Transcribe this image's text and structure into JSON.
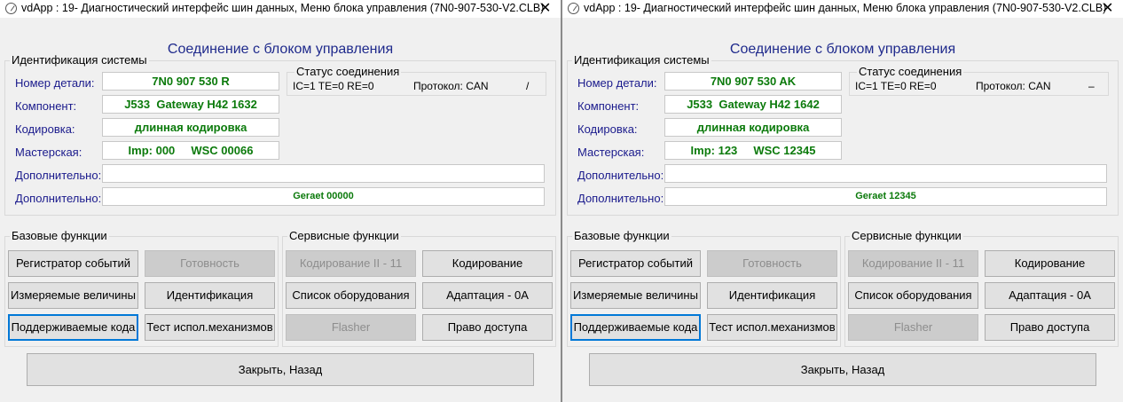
{
  "windows": [
    {
      "title": "vdApp : 19- Диагностический интерфейс шин данных,  Меню блока управления (7N0-907-530-V2.CLB)",
      "heading": "Соединение с блоком управления",
      "ident": {
        "group_label": "Идентификация системы",
        "part_label": "Номер детали:",
        "part_value": "7N0 907 530 R",
        "component_label": "Компонент:",
        "component_value": "J533  Gateway H42 1632",
        "coding_label": "Кодировка:",
        "coding_value": "длинная кодировка",
        "workshop_label": "Мастерская:",
        "workshop_value": "Imp: 000     WSC 00066",
        "extra1_label": "Дополнительно:",
        "extra1_value": "",
        "extra2_label": "Дополнительно:",
        "extra2_value": "Geraet 00000"
      },
      "status": {
        "group_label": "Статус соединения",
        "counters": "IC=1  TE=0   RE=0",
        "protocol": "Протокол: CAN",
        "indicator": "/"
      },
      "basic": {
        "group_label": "Базовые функции",
        "event_log": "Регистратор событий",
        "readiness": "Готовность",
        "measured": "Измеряемые величины",
        "identification": "Идентификация",
        "supported_codes": "Поддерживаемые кода",
        "actuator_test": "Тест испол.механизмов"
      },
      "service": {
        "group_label": "Сервисные функции",
        "coding2": "Кодирование II - 11",
        "coding": "Кодирование",
        "equipment": "Список оборудования",
        "adaptation": "Адаптация - 0А",
        "flasher": "Flasher",
        "access": "Право доступа"
      },
      "close_back": "Закрыть, Назад"
    },
    {
      "title": "vdApp : 19- Диагностический интерфейс шин данных,  Меню блока управления (7N0-907-530-V2.CLB)",
      "heading": "Соединение с блоком управления",
      "ident": {
        "group_label": "Идентификация системы",
        "part_label": "Номер детали:",
        "part_value": "7N0 907 530 AK",
        "component_label": "Компонент:",
        "component_value": "J533  Gateway H42 1642",
        "coding_label": "Кодировка:",
        "coding_value": "длинная кодировка",
        "workshop_label": "Мастерская:",
        "workshop_value": "Imp: 123     WSC 12345",
        "extra1_label": "Дополнительно:",
        "extra1_value": "",
        "extra2_label": "Дополнительно:",
        "extra2_value": "Geraet 12345"
      },
      "status": {
        "group_label": "Статус соединения",
        "counters": "IC=1  TE=0   RE=0",
        "protocol": "Протокол: CAN",
        "indicator": "–"
      },
      "basic": {
        "group_label": "Базовые функции",
        "event_log": "Регистратор событий",
        "readiness": "Готовность",
        "measured": "Измеряемые величины",
        "identification": "Идентификация",
        "supported_codes": "Поддерживаемые кода",
        "actuator_test": "Тест испол.механизмов"
      },
      "service": {
        "group_label": "Сервисные функции",
        "coding2": "Кодирование II - 11",
        "coding": "Кодирование",
        "equipment": "Список оборудования",
        "adaptation": "Адаптация - 0А",
        "flasher": "Flasher",
        "access": "Право доступа"
      },
      "close_back": "Закрыть, Назад"
    }
  ]
}
